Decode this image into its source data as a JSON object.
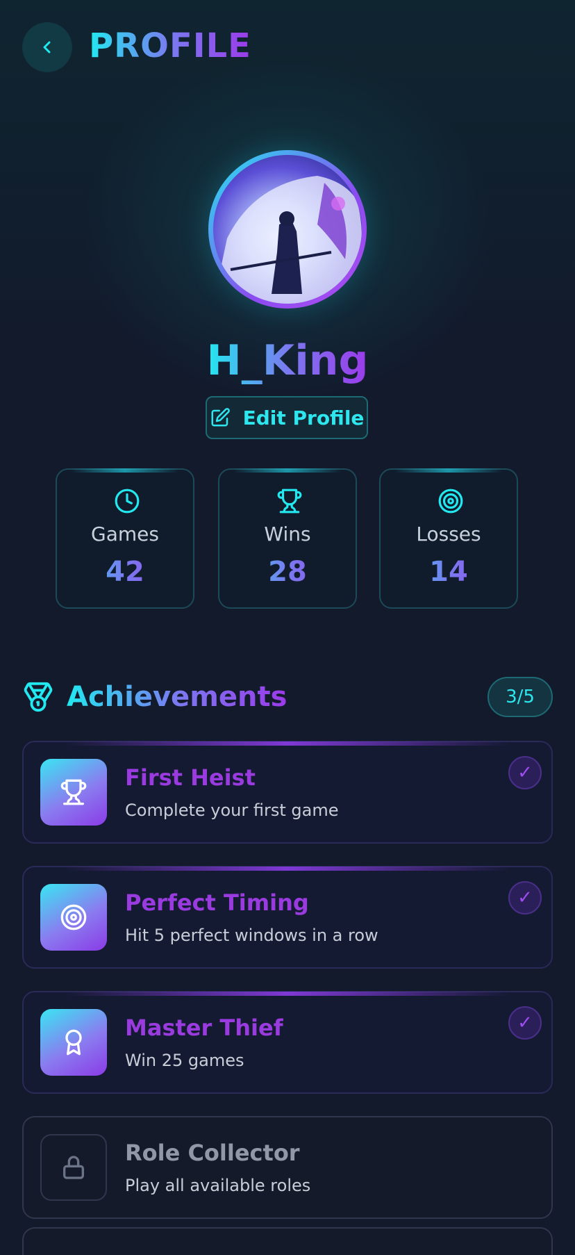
{
  "header": {
    "title": "PROFILE",
    "back_icon": "chevron-left-icon"
  },
  "profile": {
    "username": "H_King",
    "edit_label": "Edit Profile",
    "avatar": "anime-samurai-avatar"
  },
  "stats": [
    {
      "label": "Games",
      "value": "42",
      "icon": "clock-icon"
    },
    {
      "label": "Wins",
      "value": "28",
      "icon": "trophy-icon"
    },
    {
      "label": "Losses",
      "value": "14",
      "icon": "target-icon"
    }
  ],
  "achievements": {
    "title": "Achievements",
    "count": "3/5",
    "items": [
      {
        "name": "First Heist",
        "desc": "Complete your first game",
        "icon": "trophy-icon",
        "unlocked": true,
        "check": "✓"
      },
      {
        "name": "Perfect Timing",
        "desc": "Hit 5 perfect windows in a row",
        "icon": "target-icon",
        "unlocked": true,
        "check": "✓"
      },
      {
        "name": "Master Thief",
        "desc": "Win 25 games",
        "icon": "award-icon",
        "unlocked": true,
        "check": "✓"
      },
      {
        "name": "Role Collector",
        "desc": "Play all available roles",
        "icon": "lock-icon",
        "unlocked": false
      }
    ]
  },
  "colors": {
    "accent_cyan": "#22e8f0",
    "accent_purple": "#9b3bea",
    "background": "#121a2c"
  }
}
